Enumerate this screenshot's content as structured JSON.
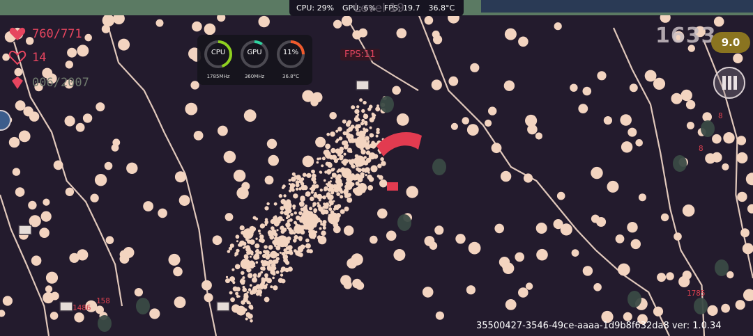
{
  "status_bar": {
    "cpu": "CPU: 29%",
    "gpu": "GPU: 6%",
    "fps": "FPS: 19.7",
    "temp": "36.8°C"
  },
  "level_label": "Level 19",
  "hud": {
    "hp": "760/771",
    "armor": "14",
    "xp": "006/2007",
    "hp_icon": "heart-icon",
    "armor_icon": "shield-heart-icon",
    "xp_icon": "gem-icon"
  },
  "perf_overlay": {
    "gauges": [
      {
        "label": "CPU",
        "sub": "1785MHz",
        "level": 0.45,
        "color": "#8fd11f"
      },
      {
        "label": "GPU",
        "sub": "360MHz",
        "level": 0.1,
        "color": "#2fd3a0"
      },
      {
        "label": "11%",
        "sub": "36.8°C",
        "level": 0.25,
        "color": "#f05a2c"
      }
    ]
  },
  "fps_tag": "FPS:11",
  "score": "1633",
  "kill_badge": "9.0",
  "pause_icon": "pause-icon",
  "damage_numbers": [
    {
      "text": "8"
    },
    {
      "text": "8"
    },
    {
      "text": "1785"
    },
    {
      "text": "158"
    },
    {
      "text": "1486"
    }
  ],
  "build_info": "35500427-3546-49ce-aaaa-1d9b8f632da8 ver: 1.0.34",
  "colors": {
    "background": "#231b2d",
    "projectile": "#f3d4c0",
    "lightning": "#f6dccb",
    "enemy": "#3a4a44",
    "player": "#e23b50",
    "hp_text": "#e6455f"
  }
}
